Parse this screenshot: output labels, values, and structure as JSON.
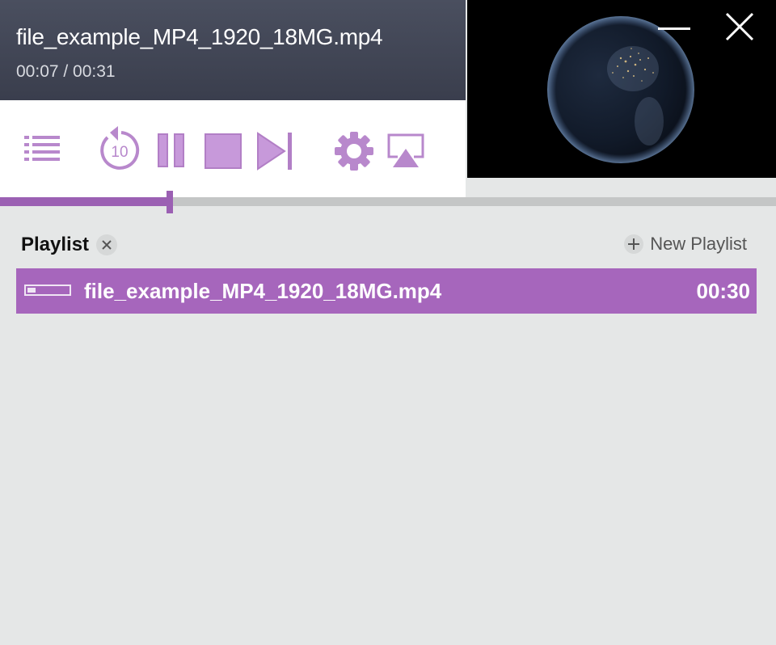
{
  "header": {
    "title": "file_example_MP4_1920_18MG.mp4",
    "timecode": "00:07 / 00:31"
  },
  "window_controls": {
    "minimize_icon": "minimize-icon",
    "close_icon": "close-icon"
  },
  "controls": {
    "playlist_icon": "list-icon",
    "rewind_icon": "replay-10-icon",
    "rewind_seconds": "10",
    "pause_icon": "pause-icon",
    "stop_icon": "stop-icon",
    "next_icon": "skip-next-icon",
    "settings_icon": "gear-icon",
    "cast_icon": "airplay-icon"
  },
  "progress": {
    "position": 0.219
  },
  "playlist": {
    "label": "Playlist",
    "new_playlist_label": "New Playlist",
    "items": [
      {
        "name": "file_example_MP4_1920_18MG.mp4",
        "duration": "00:30"
      }
    ]
  },
  "colors": {
    "accent": "#a666bc",
    "accent_dark": "#9b60b3",
    "icon": "#b888cc",
    "header_bg": "#434756",
    "body_bg": "#e5e7e7"
  }
}
